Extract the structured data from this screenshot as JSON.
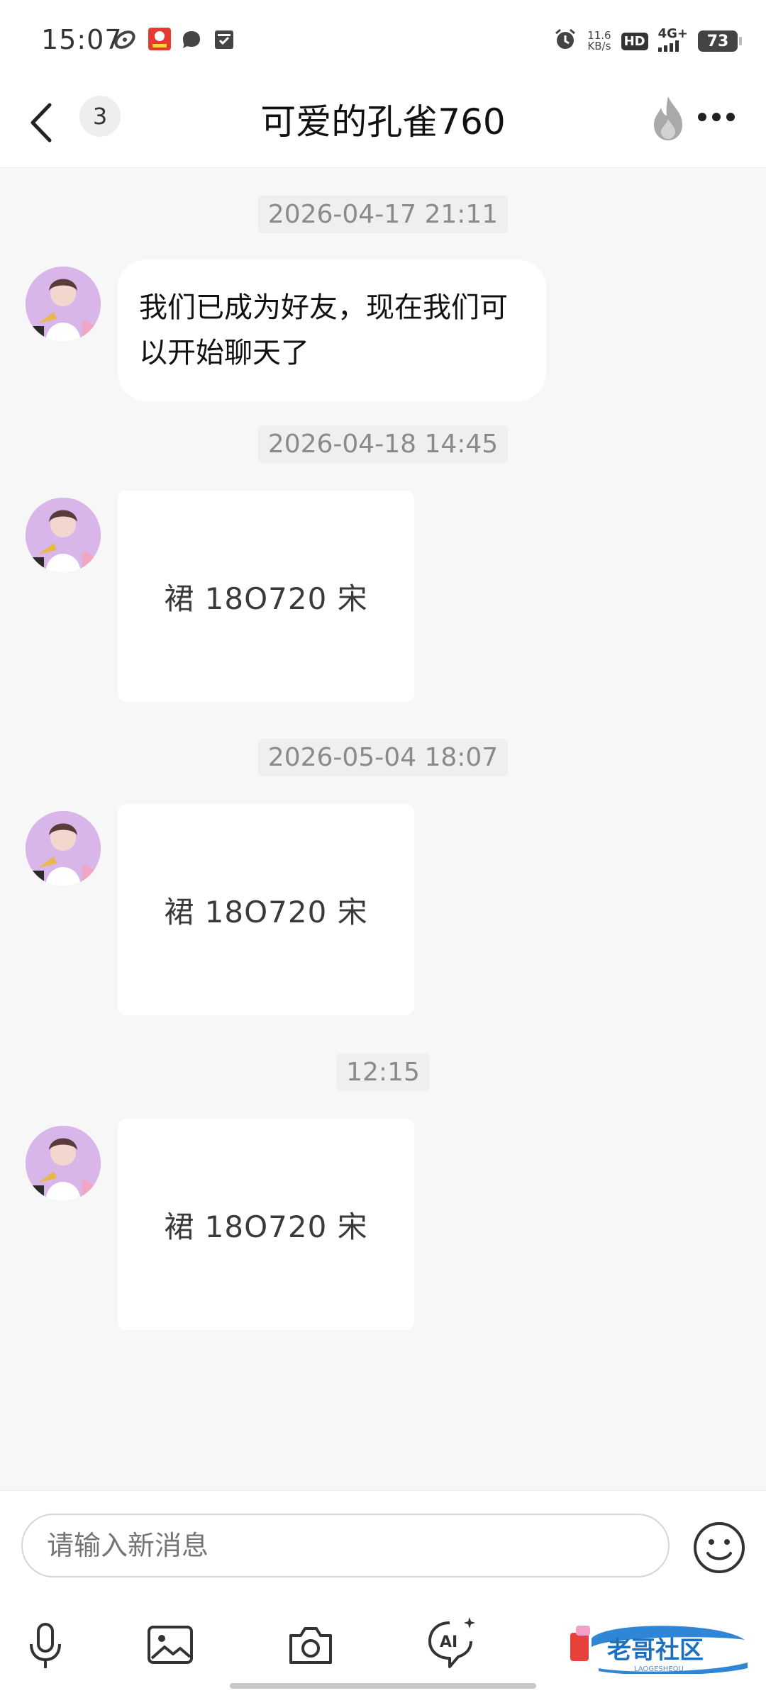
{
  "status_bar": {
    "time": "15:07",
    "net_speed_value": "11.6",
    "net_speed_unit": "KB/s",
    "hd_label": "HD",
    "network_type": "4G+",
    "battery_level": "73",
    "icons": [
      "swirl-app-icon",
      "red-app-icon",
      "message-bubble-icon",
      "inbox-icon",
      "alarm-icon",
      "signal-icon"
    ]
  },
  "nav": {
    "unread_count": "3",
    "title": "可爱的孔雀760",
    "icons": [
      "back-arrow-icon",
      "fire-icon",
      "more-icon"
    ]
  },
  "messages": [
    {
      "timestamp": "2026-04-17 21:11",
      "type": "text",
      "text": "我们已成为好友，现在我们可以开始聊天了"
    },
    {
      "timestamp": "2026-04-18 14:45",
      "type": "image",
      "image_text": "裙 18O720 宋"
    },
    {
      "timestamp": "2026-05-04 18:07",
      "type": "image",
      "image_text": "裙 18O720 宋"
    },
    {
      "timestamp": "12:15",
      "type": "image",
      "image_text": "裙 18O720 宋"
    }
  ],
  "input": {
    "placeholder": "请输入新消息"
  },
  "toolbar": {
    "icons": [
      "microphone-icon",
      "image-icon",
      "camera-icon",
      "ai-assistant-icon",
      "add-icon",
      "emoji-icon"
    ]
  },
  "watermark": {
    "text": "老哥社区",
    "subtext": "LAOGESHEQU"
  },
  "colors": {
    "background": "#f7f7f7",
    "bubble": "#ffffff",
    "timestamp_text": "#8a8a8a",
    "avatar_bg": "#d8b6ea"
  }
}
